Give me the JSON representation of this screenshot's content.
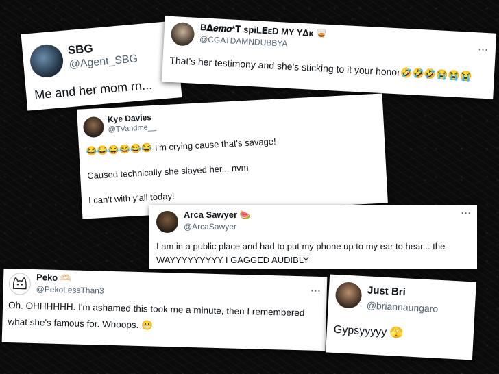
{
  "tweets": [
    {
      "name": "SBG",
      "handle": "@Agent_SBG",
      "text": "Me and her mom rn..."
    },
    {
      "name": "B𝚫𝒆𝒎𝒐*𝐓 ѕpiL𝐄ᴇD MY YΔк 🥃",
      "handle": "@CGATDAMNDUBBYA",
      "text": "That's her testimony and she's sticking to it your honor🤣🤣🤣😭😭😭",
      "menu": "···"
    },
    {
      "name": "Kye Davies",
      "handle": "@TVandme__",
      "line1": "😂😂😂😂😂😂 I'm crying cause that's savage!",
      "line2": "Caused technically she slayed her... nvm",
      "line3": "I can't with y'all today!"
    },
    {
      "name": "Arca Sawyer 🍉",
      "handle": "@ArcaSawyer",
      "line1": "I am in a public place and had to put my phone up to my ear to hear... the",
      "line2": "WAYYYYYYYYY I GAGGED AUDIBLY",
      "menu": "···"
    },
    {
      "name": "Peko 🫶🏻",
      "handle": "@PekoLessThan3",
      "line1": "Oh. OHHHHHH. I'm ashamed this took me a minute, then I remembered",
      "line2": "what she's famous for. Whoops. 😬",
      "menu": "···"
    },
    {
      "name": "Just Bri",
      "handle": "@briannaungaro",
      "text": "Gypsyyyyy 🫣"
    }
  ]
}
